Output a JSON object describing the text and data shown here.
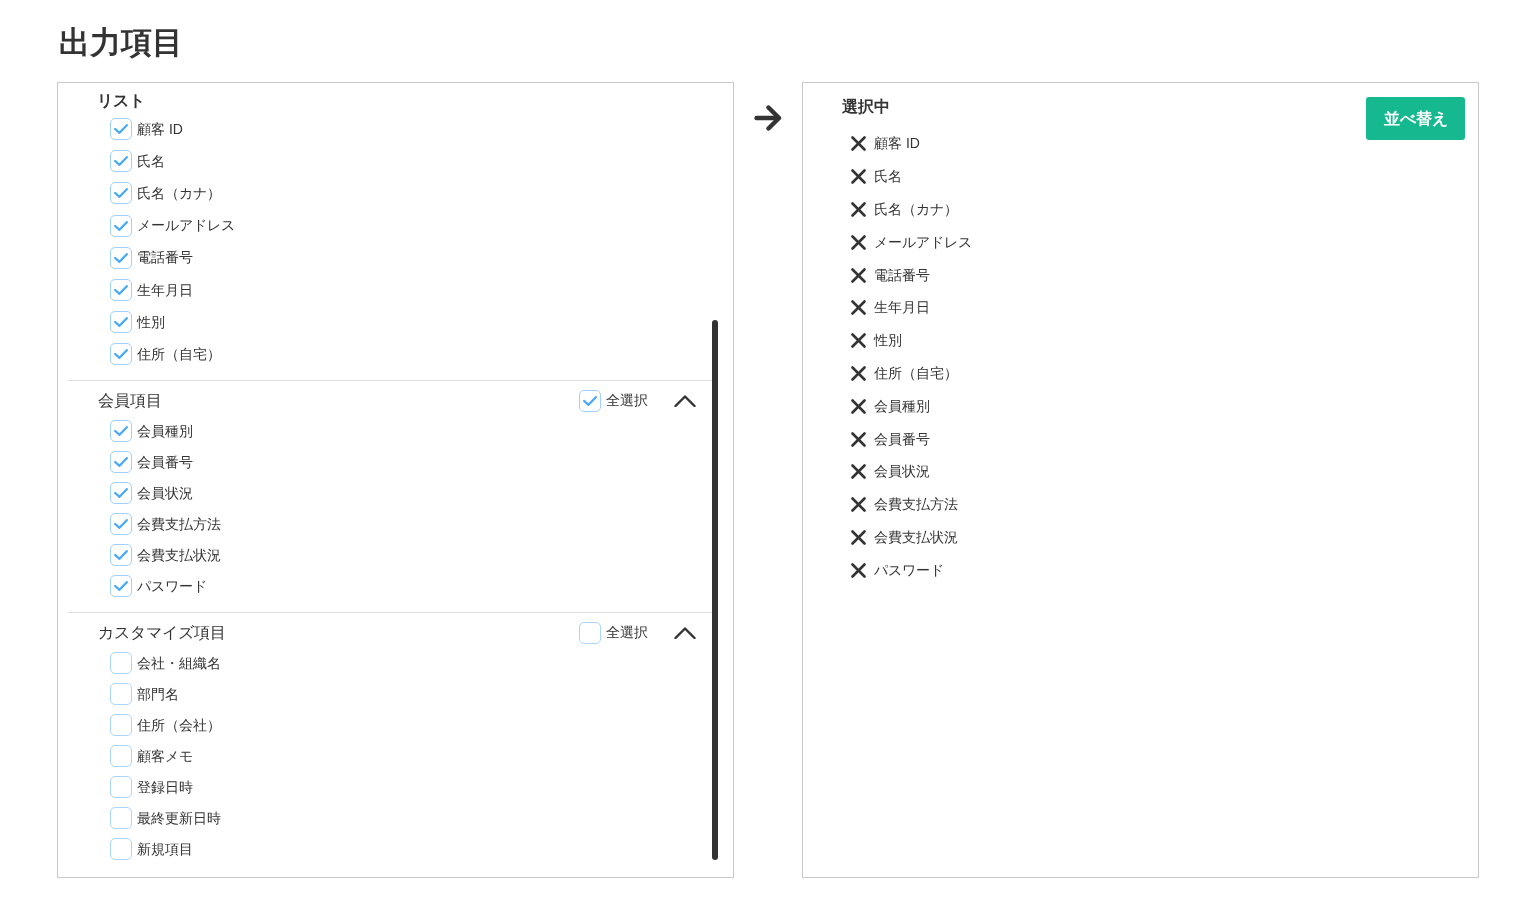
{
  "title": "出力項目",
  "field_groups": [
    {
      "kind": "plain",
      "title": "リスト",
      "items": [
        {
          "label": "顧客 ID",
          "checked": true
        },
        {
          "label": "氏名",
          "checked": true
        },
        {
          "label": "氏名（カナ）",
          "checked": true
        },
        {
          "label": "メールアドレス",
          "checked": true
        },
        {
          "label": "電話番号",
          "checked": true
        },
        {
          "label": "生年月日",
          "checked": true
        },
        {
          "label": "性別",
          "checked": true
        },
        {
          "label": "住所（自宅）",
          "checked": true
        }
      ]
    },
    {
      "kind": "collapsible",
      "title": "会員項目",
      "select_all": {
        "label": "全選択",
        "checked": true
      },
      "expanded": true,
      "items": [
        {
          "label": "会員種別",
          "checked": true
        },
        {
          "label": "会員番号",
          "checked": true
        },
        {
          "label": "会員状況",
          "checked": true
        },
        {
          "label": "会費支払方法",
          "checked": true
        },
        {
          "label": "会費支払状況",
          "checked": true
        },
        {
          "label": "パスワード",
          "checked": true
        }
      ]
    },
    {
      "kind": "collapsible",
      "title": "カスタマイズ項目",
      "select_all": {
        "label": "全選択",
        "checked": false
      },
      "expanded": true,
      "items": [
        {
          "label": "会社・組織名",
          "checked": false
        },
        {
          "label": "部門名",
          "checked": false
        },
        {
          "label": "住所（会社）",
          "checked": false
        },
        {
          "label": "顧客メモ",
          "checked": false
        },
        {
          "label": "登録日時",
          "checked": false
        },
        {
          "label": "最終更新日時",
          "checked": false
        },
        {
          "label": "新規項目",
          "checked": false
        }
      ]
    }
  ],
  "selected_panel": {
    "title": "選択中",
    "sort_button": "並べ替え",
    "items": [
      "顧客 ID",
      "氏名",
      "氏名（カナ）",
      "メールアドレス",
      "電話番号",
      "生年月日",
      "性別",
      "住所（自宅）",
      "会員種別",
      "会員番号",
      "会員状況",
      "会費支払方法",
      "会費支払状況",
      "パスワード"
    ]
  }
}
